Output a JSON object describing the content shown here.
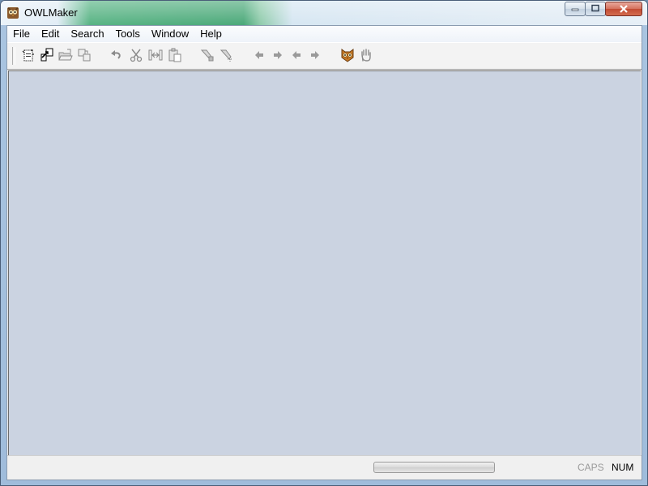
{
  "window": {
    "title": "OWLMaker"
  },
  "menu": [
    "File",
    "Edit",
    "Search",
    "Tools",
    "Window",
    "Help"
  ],
  "toolbar": [
    {
      "name": "new-file-icon"
    },
    {
      "name": "open-file-icon"
    },
    {
      "name": "open-folder-icon"
    },
    {
      "name": "copy-document-icon"
    },
    {
      "name": "undo-icon"
    },
    {
      "name": "cut-icon"
    },
    {
      "name": "split-icon"
    },
    {
      "name": "paste-icon"
    },
    {
      "name": "find-icon"
    },
    {
      "name": "find-next-icon"
    },
    {
      "name": "back-arrow-icon"
    },
    {
      "name": "forward-arrow-icon"
    },
    {
      "name": "prev-arrow-icon"
    },
    {
      "name": "next-arrow-icon"
    },
    {
      "name": "owl-icon"
    },
    {
      "name": "hand-icon"
    }
  ],
  "statusbar": {
    "caps": "CAPS",
    "num": "NUM",
    "progress": 0
  }
}
